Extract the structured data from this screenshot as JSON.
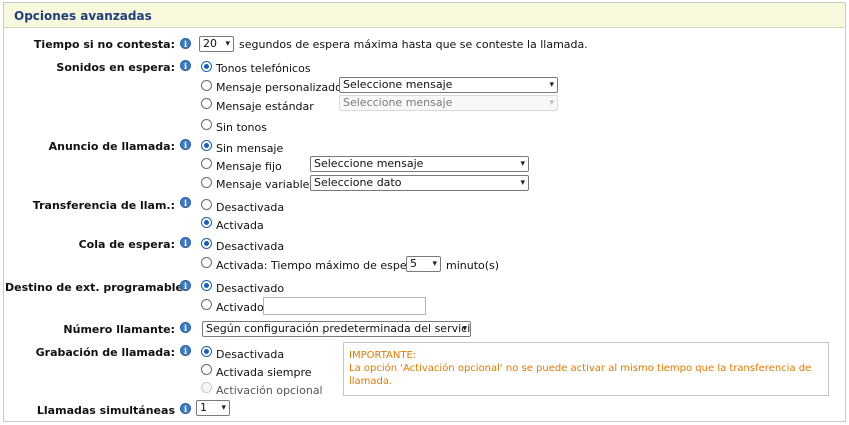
{
  "header": {
    "title": "Opciones avanzadas"
  },
  "info_icon_glyph": "i",
  "chevron_glyph": "▾",
  "tiempo": {
    "label": "Tiempo si no contesta:",
    "select_value": "20",
    "suffix": "segundos de espera máxima hasta que se conteste la llamada."
  },
  "sonidos": {
    "label": "Sonidos en espera:",
    "options": [
      "Tonos telefónicos",
      "Mensaje personalizado",
      "Mensaje estándar",
      "Sin tonos"
    ],
    "selected_index": 0,
    "select_personalizado": "Seleccione mensaje",
    "select_estandar": "Seleccione mensaje"
  },
  "anuncio": {
    "label": "Anuncio de llamada:",
    "options": [
      "Sin mensaje",
      "Mensaje fijo",
      "Mensaje variable"
    ],
    "selected_index": 0,
    "select_fijo": "Seleccione mensaje",
    "select_variable": "Seleccione dato"
  },
  "transferencia": {
    "label": "Transferencia de llam.:",
    "options": [
      "Desactivada",
      "Activada"
    ],
    "selected_index": 1
  },
  "cola": {
    "label": "Cola de espera:",
    "options": [
      "Desactivada",
      "Activada:"
    ],
    "selected_index": 0,
    "tiempo_label": "Tiempo máximo de espera",
    "tiempo_value": "5",
    "tiempo_unit": "minuto(s)"
  },
  "destino": {
    "label": "Destino de ext. programable:",
    "options": [
      "Desactivado",
      "Activado"
    ],
    "selected_index": 0,
    "input_value": ""
  },
  "numero": {
    "label": "Número llamante:",
    "select_value": "Según configuración predeterminada del servicio"
  },
  "grabacion": {
    "label": "Grabación de llamada:",
    "options": [
      "Desactivada",
      "Activada siempre",
      "Activación opcional"
    ],
    "selected_index": 0,
    "notice_title": "IMPORTANTE:",
    "notice_text": "La opción 'Activación opcional' no se puede activar al mismo tiempo que la transferencia de llamada."
  },
  "simultaneas": {
    "label": "Llamadas simultáneas",
    "select_value": "1"
  },
  "colors": {
    "header_bg": "#f8f8dc",
    "header_text": "#1f3f7a",
    "accent": "#1a5fb4",
    "notice_text": "#e07b00"
  }
}
